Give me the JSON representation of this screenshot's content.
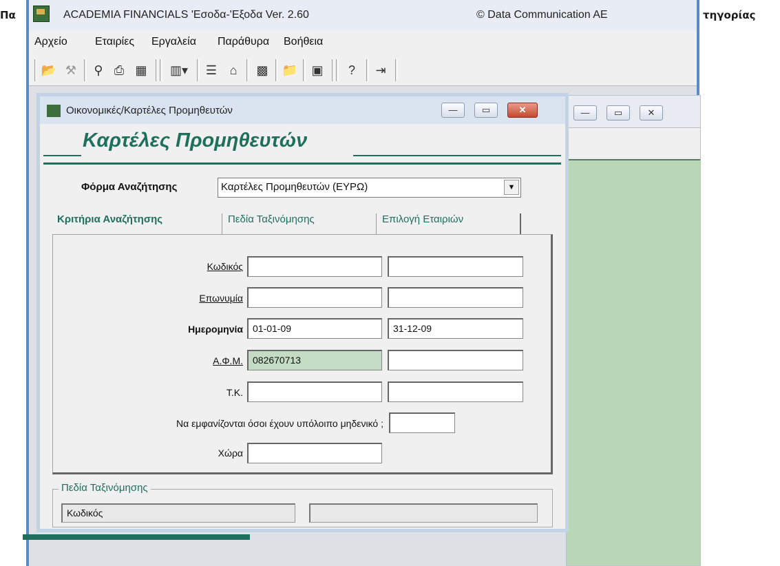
{
  "background_text": {
    "left": "Πα",
    "right": "τηγορίας"
  },
  "app": {
    "title": "ACADEMIA FINANCIALS 'Εσοδα-'Εξοδα Ver. 2.60",
    "copyright": "© Data Communication AE"
  },
  "menu": [
    "Αρχείο",
    "Εταιρίες",
    "Εργαλεία",
    "Παράθυρα",
    "Βοήθεια"
  ],
  "toolbar_icons": [
    "open-folder-icon",
    "binoculars-tool-icon",
    "binoculars-icon",
    "printer-icon",
    "calculator-icon",
    "columns-dropdown-icon",
    "document-list-icon",
    "bank-icon",
    "chart-icon",
    "open-folder-2-icon",
    "screen-icon",
    "help-icon",
    "exit-icon"
  ],
  "child_window": {
    "title": "Οικονομικές/Καρτέλες Προμηθευτών",
    "heading": "Καρτέλες Προμηθευτών"
  },
  "search_form": {
    "label": "Φόρμα Αναζήτησης",
    "value": "Καρτέλες Προμηθευτών (ΕΥΡΩ)"
  },
  "tabs": [
    "Κριτήρια Αναζήτησης",
    "Πεδία Ταξινόμησης",
    "Επιλογή Εταιριών"
  ],
  "fields": {
    "code": {
      "label": "Κωδικός",
      "from": "",
      "to": ""
    },
    "name": {
      "label": "Επωνυμία",
      "from": "",
      "to": ""
    },
    "date": {
      "label": "Ημερομηνία",
      "from": "01-01-09",
      "to": "31-12-09"
    },
    "afm": {
      "label": "Α.Φ.Μ.",
      "from": "082670713",
      "to": ""
    },
    "tk": {
      "label": "Τ.Κ.",
      "from": "",
      "to": ""
    },
    "zero_balance": {
      "label": "Να εμφανίζονται όσοι έχουν υπόλοιπο μηδενικό ;",
      "value": ""
    },
    "country": {
      "label": "Χώρα",
      "value": ""
    }
  },
  "sort_group": {
    "legend": "Πεδία Ταξινόμησης",
    "field1": "Κωδικός",
    "field2": ""
  },
  "colors": {
    "accent_green": "#1e6f5c",
    "highlight_field": "#c3dcc3",
    "close_red": "#c44a30"
  }
}
